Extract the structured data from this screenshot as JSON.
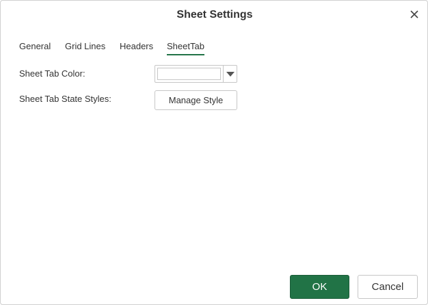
{
  "dialog": {
    "title": "Sheet Settings",
    "close_icon": "close-icon"
  },
  "tabs": [
    {
      "label": "General",
      "active": false
    },
    {
      "label": "Grid Lines",
      "active": false
    },
    {
      "label": "Headers",
      "active": false
    },
    {
      "label": "SheetTab",
      "active": true
    }
  ],
  "sheet_tab": {
    "color_label": "Sheet Tab Color:",
    "color_value": "#ffffff",
    "dropdown_icon": "triangle-down-icon",
    "state_styles_label": "Sheet Tab State Styles:",
    "manage_style_button": "Manage Style"
  },
  "footer": {
    "ok_label": "OK",
    "cancel_label": "Cancel"
  },
  "colors": {
    "accent": "#217346",
    "text": "#333333",
    "border": "#c6c6c6"
  }
}
